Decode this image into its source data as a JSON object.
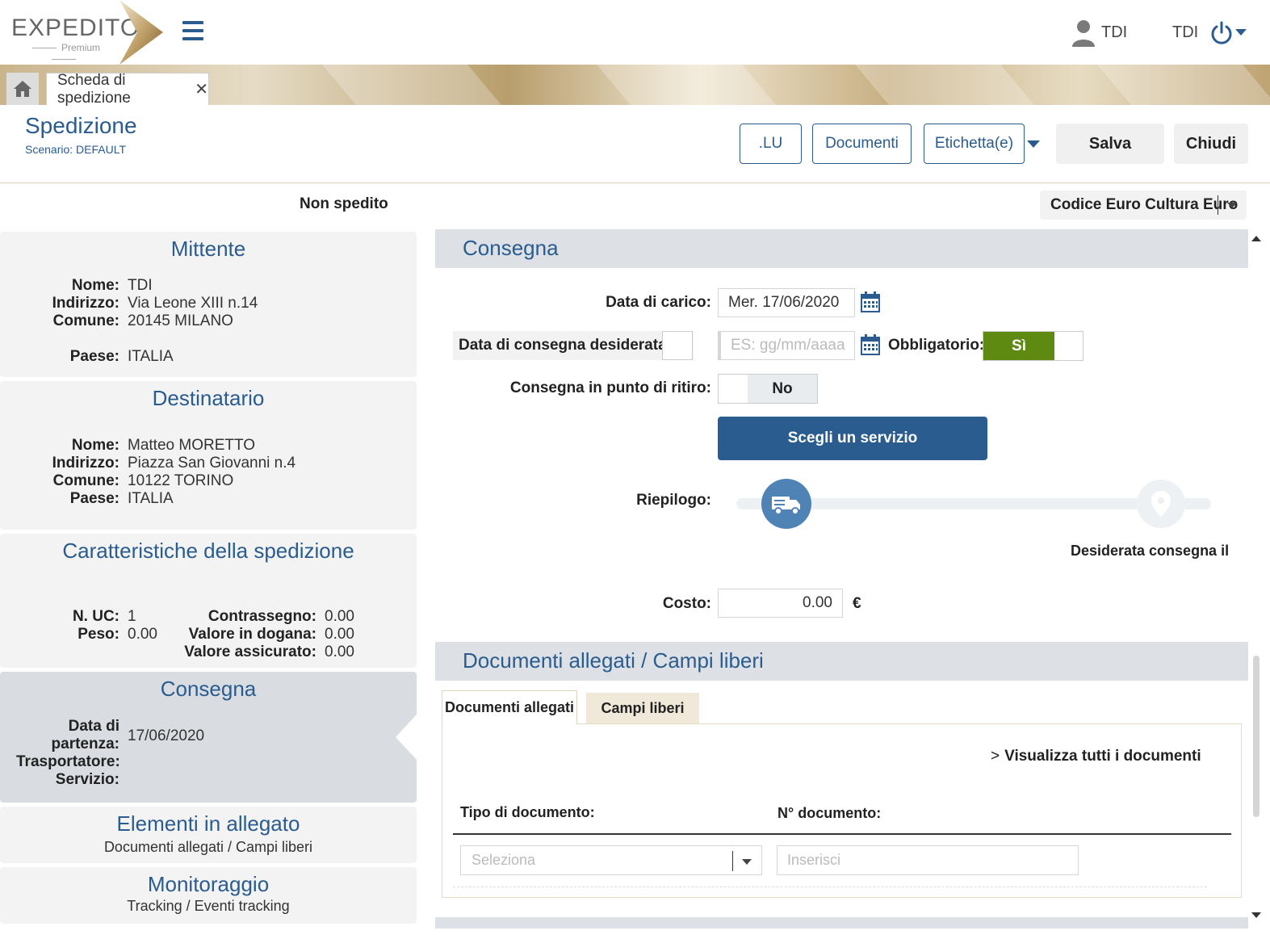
{
  "header": {
    "logo_text": "EXPEDITO",
    "logo_sub": "Premium",
    "user_label": "TDI",
    "user_label2": "TDI"
  },
  "tabs": {
    "active_tab": "Scheda di spedizione",
    "close_glyph": "✕"
  },
  "title": {
    "heading": "Spedizione",
    "scenario": "Scenario: DEFAULT"
  },
  "toolbar": {
    "lu": ".LU",
    "documenti": "Documenti",
    "etichetta": "Etichetta(e)",
    "salva": "Salva",
    "chiudi": "Chiudi"
  },
  "status": "Non spedito",
  "codice_select": "Codice Euro Cultura Euro",
  "mittente": {
    "title": "Mittente",
    "nome_k": "Nome:",
    "nome": "TDI",
    "indirizzo_k": "Indirizzo:",
    "indirizzo": "Via  Leone XIII n.14",
    "comune_k": "Comune:",
    "comune": "20145 MILANO",
    "paese_k": "Paese:",
    "paese": "ITALIA"
  },
  "destinatario": {
    "title": "Destinatario",
    "nome_k": "Nome:",
    "nome": "Matteo MORETTO",
    "indirizzo_k": "Indirizzo:",
    "indirizzo": "Piazza San Giovanni n.4",
    "comune_k": "Comune:",
    "comune": "10122 TORINO",
    "paese_k": "Paese:",
    "paese": "ITALIA"
  },
  "caratteristiche": {
    "title": "Caratteristiche della spedizione",
    "nuc_k": "N. UC:",
    "nuc": "1",
    "peso_k": "Peso:",
    "peso": "0.00",
    "contrassegno_k": "Contrassegno:",
    "contrassegno": "0.00",
    "dogana_k": "Valore in dogana:",
    "dogana": "0.00",
    "assicurato_k": "Valore assicurato:",
    "assicurato": "0.00"
  },
  "consegna_panel": {
    "title": "Consegna",
    "data_k1": "Data di",
    "data_k2": "partenza:",
    "data": "17/06/2020",
    "trasportatore_k": "Trasportatore:",
    "servizio_k": "Servizio:"
  },
  "elementi": {
    "title": "Elementi in allegato",
    "sub": "Documenti allegati / Campi liberi"
  },
  "monitoraggio": {
    "title": "Monitoraggio",
    "sub": "Tracking / Eventi tracking"
  },
  "consegna": {
    "section_title": "Consegna",
    "data_carico_label": "Data di carico:",
    "data_carico_value": "Mer.  17/06/2020",
    "desiderata_label": "Data di consegna desiderata",
    "desiderata_placeholder": "ES: gg/mm/aaaa",
    "obbligatorio_label": "Obbligatorio:",
    "obbligatorio_value": "Sì",
    "punto_ritiro_label": "Consegna in punto di ritiro:",
    "punto_ritiro_value": "No",
    "scegli_button": "Scegli un servizio",
    "riepilogo_label": "Riepilogo:",
    "desiderata_consegna": "Desiderata consegna il",
    "costo_label": "Costo:",
    "costo_value": "0.00",
    "currency": "€"
  },
  "documenti": {
    "section_title": "Documenti allegati / Campi liberi",
    "tab_allegati": "Documenti allegati",
    "tab_campi": "Campi liberi",
    "link": "Visualizza tutti i documenti",
    "col_tipo": "Tipo di documento:",
    "col_numero": "N° documento:",
    "tipo_placeholder": "Seleziona",
    "numero_placeholder": "Inserisci"
  },
  "colors": {
    "brand_blue": "#2a5c8f",
    "toggle_green": "#5f8a12",
    "truck_blue": "#4f82b5"
  }
}
